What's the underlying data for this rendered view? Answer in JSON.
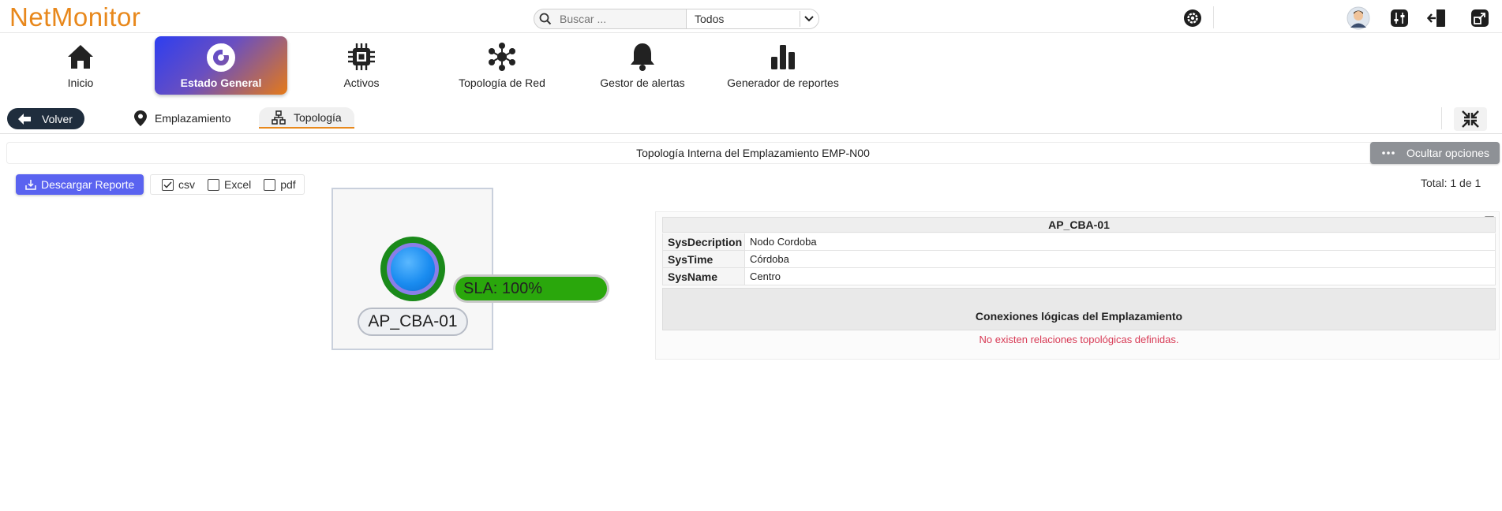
{
  "app": {
    "logo": "NetMonitor"
  },
  "search": {
    "placeholder": "Buscar ...",
    "filter_value": "Todos"
  },
  "header_icons": [
    "gear-icon",
    "avatar",
    "sliders-icon",
    "logout-icon",
    "external-link-icon"
  ],
  "nav": {
    "items": [
      {
        "label": "Inicio",
        "icon": "home-icon"
      },
      {
        "label": "Estado General",
        "icon": "donut-chart-icon",
        "active": true
      },
      {
        "label": "Activos",
        "icon": "chip-icon"
      },
      {
        "label": "Topología de Red",
        "icon": "network-icon"
      },
      {
        "label": "Gestor de alertas",
        "icon": "bell-icon"
      },
      {
        "label": "Generador de reportes",
        "icon": "bar-chart-icon"
      }
    ]
  },
  "subnav": {
    "back_label": "Volver",
    "tabs": [
      {
        "label": "Emplazamiento",
        "icon": "map-pin-icon"
      },
      {
        "label": "Topología",
        "icon": "sitemap-icon",
        "active": true
      }
    ]
  },
  "titlebar": {
    "title": "Topología Interna del Emplazamiento EMP-N00",
    "toggle_label": "Ocultar opciones"
  },
  "report": {
    "download_label": "Descargar Reporte",
    "formats": [
      {
        "label": "csv",
        "checked": true
      },
      {
        "label": "Excel",
        "checked": false
      },
      {
        "label": "pdf",
        "checked": false
      }
    ],
    "total": "Total: 1 de 1"
  },
  "topology": {
    "node_name": "AP_CBA-01",
    "sla": "SLA: 100%"
  },
  "panel": {
    "title": "AP_CBA-01",
    "rows": [
      {
        "key": "SysDecription",
        "value": "Nodo Cordoba"
      },
      {
        "key": "SysTime",
        "value": "Córdoba"
      },
      {
        "key": "SysName",
        "value": "Centro"
      }
    ],
    "section_title": "Conexiones lógicas del Emplazamiento",
    "empty_message": "No existen relaciones topológicas definidas."
  },
  "colors": {
    "brand": "#e8881c",
    "active_gradient_start": "#2d3ef0",
    "active_gradient_end": "#e57a18",
    "download_button": "#5a63f0",
    "back_button": "#1f2d3d",
    "sla_green": "#2aa70c",
    "error_text": "#d83a55"
  }
}
